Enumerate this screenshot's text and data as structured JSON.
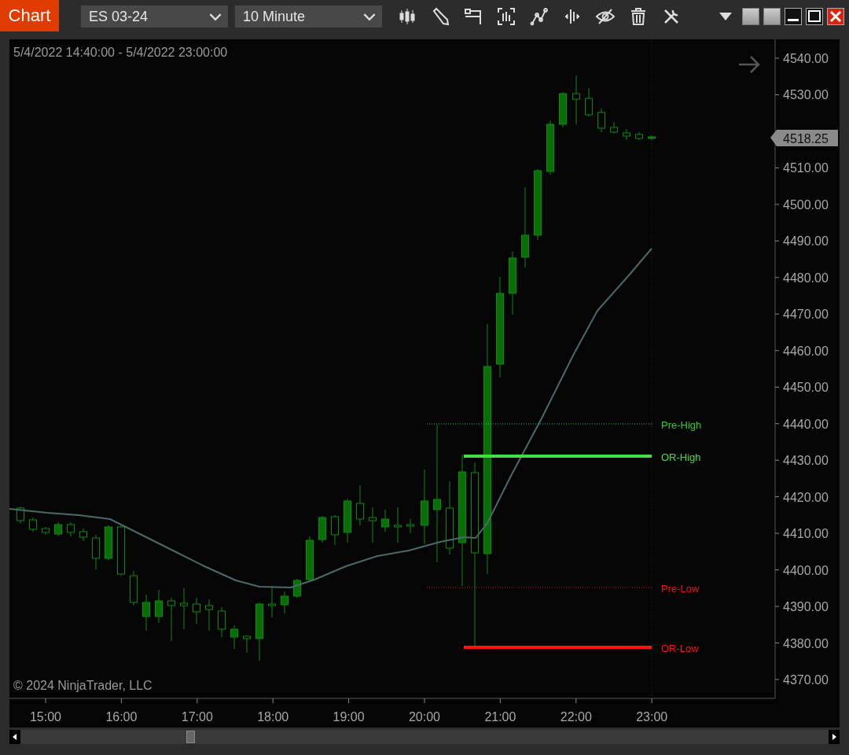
{
  "window": {
    "title": "Chart"
  },
  "toolbar": {
    "instrument": "ES 03-24",
    "interval": "10 Minute"
  },
  "chart": {
    "date_range": "5/4/2022 14:40:00 - 5/4/2022 23:00:00",
    "copyright": "© 2024 NinjaTrader, LLC",
    "current_price": "4518.25",
    "y_ticks": [
      "4540.00",
      "4530.00",
      "4510.00",
      "4500.00",
      "4490.00",
      "4480.00",
      "4470.00",
      "4460.00",
      "4450.00",
      "4440.00",
      "4430.00",
      "4420.00",
      "4410.00",
      "4400.00",
      "4390.00",
      "4380.00",
      "4370.00"
    ],
    "x_ticks": [
      "15:00",
      "16:00",
      "17:00",
      "18:00",
      "19:00",
      "20:00",
      "21:00",
      "22:00",
      "23:00"
    ],
    "levels": [
      {
        "label": "Pre-High",
        "kind": "dotted",
        "color": "#33cc33"
      },
      {
        "label": "OR-High",
        "kind": "solid",
        "color": "#44dd44"
      },
      {
        "label": "Pre-Low",
        "kind": "dotted",
        "color": "#ee1111"
      },
      {
        "label": "OR-Low",
        "kind": "solid",
        "color": "#ff1111"
      }
    ]
  }
}
